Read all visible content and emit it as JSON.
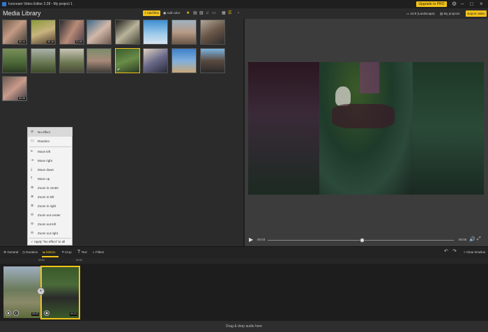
{
  "app": {
    "title": "Icecream Video Editor 2.28 - My project 1",
    "upgrade_label": "Upgrade to PRO"
  },
  "library": {
    "title": "Media Library",
    "add_files_label": "Add files",
    "add_color_label": "Add color",
    "durations": [
      "00:14",
      "00:16",
      "01:09",
      "00:26"
    ]
  },
  "header_right": {
    "aspect_label": "16:9 (Landscape)",
    "my_projects_label": "My projects",
    "export_label": "Export video"
  },
  "player": {
    "current_time": "00:03",
    "total_time": "00:06",
    "progress": 0.51
  },
  "motion_menu": {
    "items": [
      "No effect",
      "Random",
      "Move left",
      "Move right",
      "Move down",
      "Move up",
      "Zoom in center",
      "Zoom in left",
      "Zoom in right",
      "Zoom out center",
      "Zoom out left",
      "Zoom out right"
    ],
    "apply_all_label": "Apply \"No effect\" to all",
    "selected": "No effect"
  },
  "toolbar": {
    "general": "General",
    "duration": "Duration",
    "motion": "Motion",
    "crop": "Crop",
    "text": "Text",
    "filters": "Filters",
    "clear_timeline": "Clear timeline"
  },
  "timeline": {
    "ruler_marks": [
      "00:02",
      "00:04"
    ],
    "clip1_duration": "00:03",
    "clip2_duration": "00:03",
    "audio_drop_label": "Drag & drop audio here"
  },
  "colors": {
    "accent": "#f2c318",
    "background": "#2b2b2b"
  }
}
